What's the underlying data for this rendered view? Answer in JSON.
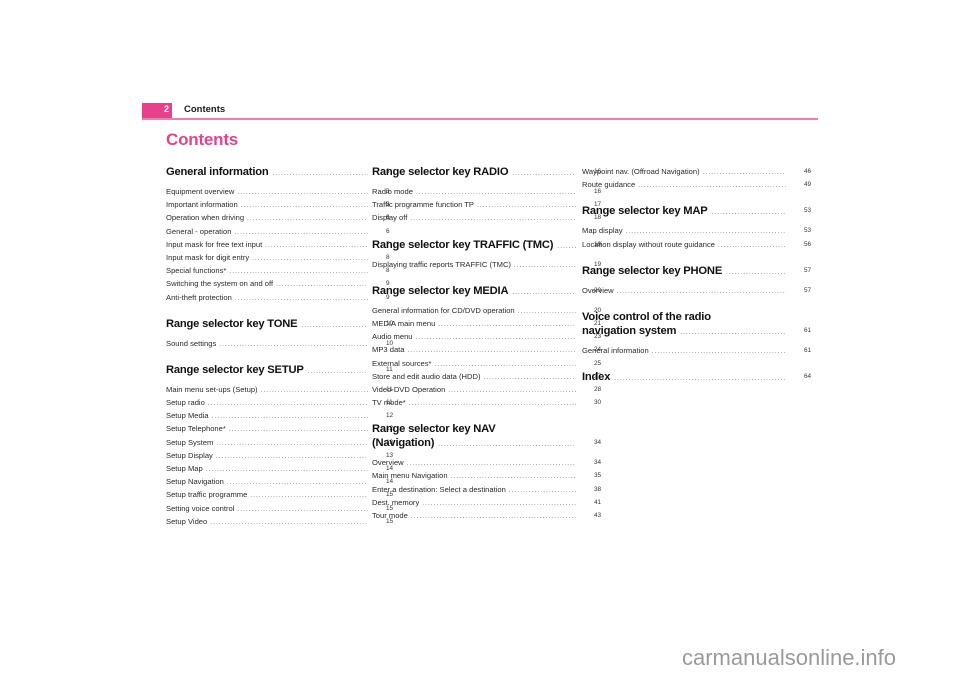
{
  "header": {
    "page_number": "2",
    "title": "Contents",
    "accent_color": "#e8418c"
  },
  "page_title": "Contents",
  "columns": [
    {
      "sections": [
        {
          "title": "General information",
          "page": "3",
          "entries": [
            {
              "title": "Equipment overview",
              "page": "3"
            },
            {
              "title": "Important information",
              "page": "3"
            },
            {
              "title": "Operation when driving",
              "page": "6"
            },
            {
              "title": "General - operation",
              "page": "6"
            },
            {
              "title": "Input mask for free text input",
              "page": "7"
            },
            {
              "title": "Input mask for digit entry",
              "page": "8"
            },
            {
              "title": "Special functions*",
              "page": "8"
            },
            {
              "title": "Switching the system on and off",
              "page": "9"
            },
            {
              "title": "Anti-theft protection",
              "page": "9"
            }
          ]
        },
        {
          "title": "Range selector key TONE",
          "page": "10",
          "entries": [
            {
              "title": "Sound settings",
              "page": "10"
            }
          ]
        },
        {
          "title": "Range selector key SETUP",
          "page": "11",
          "entries": [
            {
              "title": "Main menu set-ups (Setup)",
              "page": "11"
            },
            {
              "title": "Setup radio",
              "page": "11"
            },
            {
              "title": "Setup Media",
              "page": "12"
            },
            {
              "title": "Setup Telephone*",
              "page": "12"
            },
            {
              "title": "Setup System",
              "page": "13"
            },
            {
              "title": "Setup Display",
              "page": "13"
            },
            {
              "title": "Setup Map",
              "page": "14"
            },
            {
              "title": "Setup Navigation",
              "page": "14"
            },
            {
              "title": "Setup traffic programme",
              "page": "15"
            },
            {
              "title": "Setting voice control",
              "page": "15"
            },
            {
              "title": "Setup Video",
              "page": "15"
            }
          ]
        }
      ]
    },
    {
      "sections": [
        {
          "title": "Range selector key RADIO",
          "page": "16",
          "entries": [
            {
              "title": "Radio mode",
              "page": "16"
            },
            {
              "title": "Traffic programme function TP",
              "page": "17"
            },
            {
              "title": "Display off",
              "page": "18"
            }
          ]
        },
        {
          "title": "Range selector key TRAFFIC (TMC)",
          "page": "19",
          "entries": [
            {
              "title": "Displaying traffic reports TRAFFIC (TMC)",
              "page": "19"
            }
          ]
        },
        {
          "title": "Range selector key MEDIA",
          "page": "20",
          "entries": [
            {
              "title": "General information for CD/DVD operation",
              "page": "20"
            },
            {
              "title": "MEDIA main menu",
              "page": "21"
            },
            {
              "title": "Audio menu",
              "page": "23"
            },
            {
              "title": "MP3 data",
              "page": "24"
            },
            {
              "title": "External sources*",
              "page": "25"
            },
            {
              "title": "Store and edit audio data (HDD)",
              "page": "27"
            },
            {
              "title": "Video-DVD Operation",
              "page": "28"
            },
            {
              "title": "TV mode*",
              "page": "30"
            }
          ]
        },
        {
          "title_line1": "Range selector key NAV",
          "title": "(Navigation)",
          "page": "34",
          "entries": [
            {
              "title": "Overview",
              "page": "34"
            },
            {
              "title": "Main menu Navigation",
              "page": "35"
            },
            {
              "title": "Enter a destination: Select a destination",
              "page": "38"
            },
            {
              "title": "Dest. memory",
              "page": "41"
            },
            {
              "title": "Tour mode",
              "page": "43"
            }
          ]
        }
      ]
    },
    {
      "sections": [
        {
          "title": null,
          "page": null,
          "entries": [
            {
              "title": "Waypoint nav. (Offroad Navigation)",
              "page": "46"
            },
            {
              "title": "Route guidance",
              "page": "49"
            }
          ]
        },
        {
          "title": "Range selector key MAP",
          "page": "53",
          "entries": [
            {
              "title": "Map display",
              "page": "53"
            },
            {
              "title": "Location display without route guidance",
              "page": "56"
            }
          ]
        },
        {
          "title": "Range selector key PHONE",
          "page": "57",
          "entries": [
            {
              "title": "Overview",
              "page": "57"
            }
          ]
        },
        {
          "title_line1": "Voice control of the radio",
          "title": "navigation system",
          "page": "61",
          "entries": [
            {
              "title": "General information",
              "page": "61"
            }
          ]
        },
        {
          "title": "Index",
          "page": "64",
          "entries": []
        }
      ]
    }
  ],
  "watermark": "carmanualsonline.info"
}
